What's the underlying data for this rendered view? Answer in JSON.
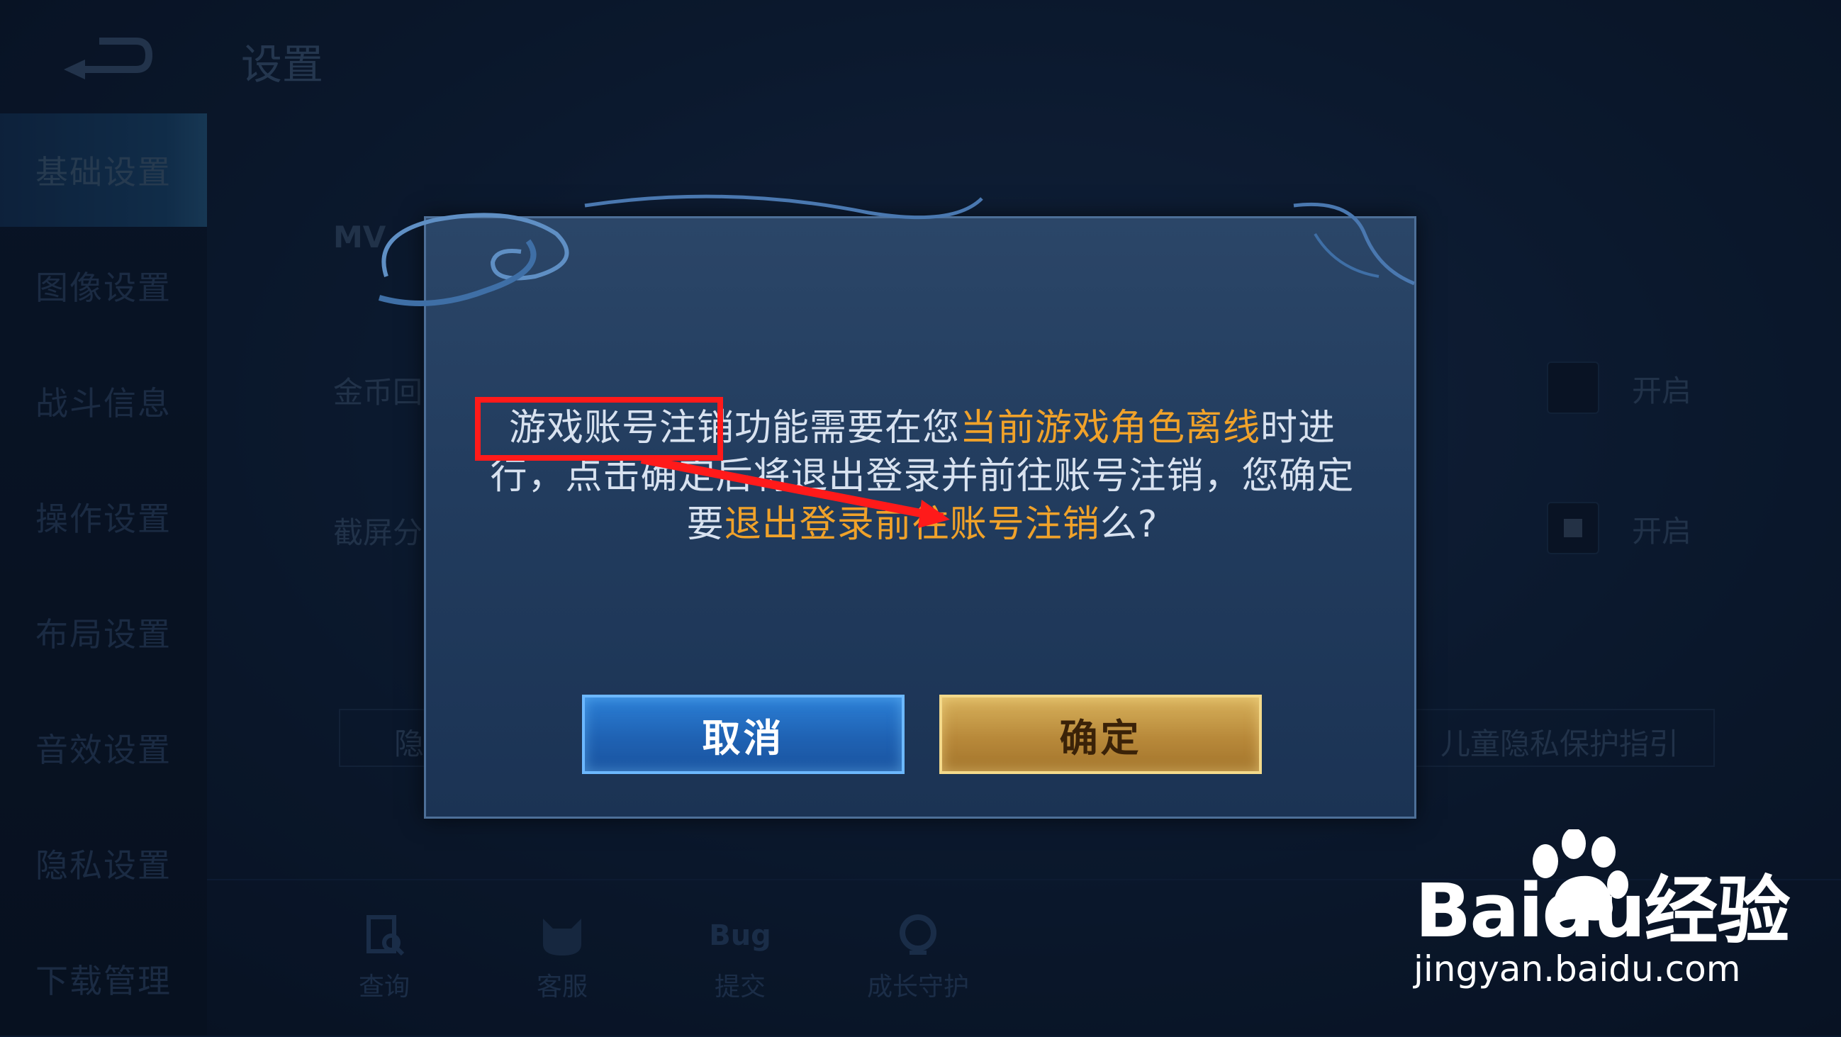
{
  "header": {
    "title": "设置"
  },
  "sidebar": {
    "items": [
      {
        "label": "基础设置"
      },
      {
        "label": "图像设置"
      },
      {
        "label": "战斗信息"
      },
      {
        "label": "操作设置"
      },
      {
        "label": "布局设置"
      },
      {
        "label": "音效设置"
      },
      {
        "label": "隐私设置"
      },
      {
        "label": "下载管理"
      }
    ],
    "active_index": 0
  },
  "background": {
    "mvp_label": "MV",
    "coin_label": "金币回",
    "screenshot_label": "截屏分",
    "toggle1_label": "开启",
    "toggle2_label": "开启",
    "privacy_btn": "隐",
    "child_privacy_btn": "儿童隐私保护指引"
  },
  "dock": {
    "items": [
      {
        "label": "查询",
        "icon": "search-doc-icon"
      },
      {
        "label": "客服",
        "icon": "cat-service-icon"
      },
      {
        "label": "提交",
        "icon_text": "Bug"
      },
      {
        "label": "成长守护",
        "icon": "shield-icon"
      }
    ]
  },
  "dialog": {
    "msg_part1": "游戏账号注销",
    "msg_part2": "功能需要在您",
    "msg_part3": "当前游戏角色离线",
    "msg_part4": "时进行，点击确定后将退出登录并前往账号注销，您确定要",
    "msg_part5": "退出登录前往账号注销",
    "msg_part6": "么?",
    "cancel_label": "取消",
    "confirm_label": "确定"
  },
  "watermark": {
    "logo": "Baidu经验",
    "url": "jingyan.baidu.com"
  },
  "colors": {
    "highlight": "#f0a22a",
    "annotation": "#ff1a1a",
    "confirm_gold": "#c39a45",
    "cancel_blue": "#1f62b3"
  }
}
